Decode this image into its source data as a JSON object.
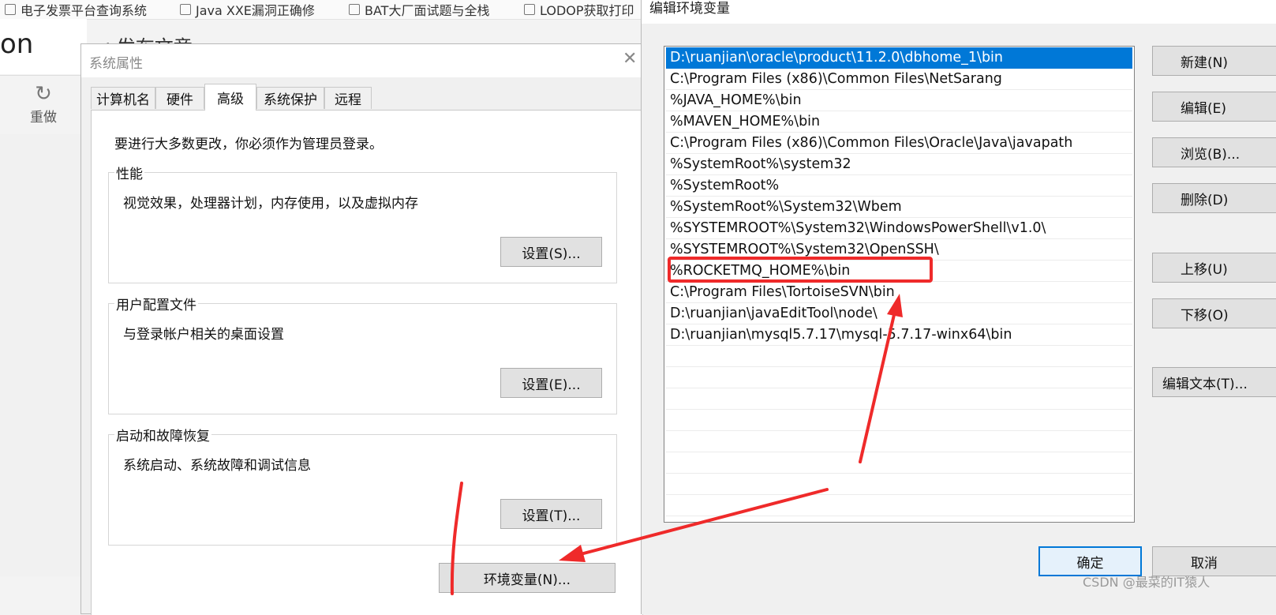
{
  "browser": {
    "bookmarks": [
      "电子发票平台查询系统",
      "Java XXE漏洞正确修",
      "BAT大厂面试题与全栈",
      "LODOP获取打印"
    ],
    "logo_fragment": "on",
    "page_title": "< 发布文章",
    "redo_label": "重做"
  },
  "system_properties": {
    "title": "系统属性",
    "tabs": [
      {
        "label": "计算机名"
      },
      {
        "label": "硬件"
      },
      {
        "label": "高级",
        "active": true
      },
      {
        "label": "系统保护"
      },
      {
        "label": "远程"
      }
    ],
    "admin_note": "要进行大多数更改，你必须作为管理员登录。",
    "groups": [
      {
        "title": "性能",
        "description": "视觉效果，处理器计划，内存使用，以及虚拟内存",
        "button": "设置(S)..."
      },
      {
        "title": "用户配置文件",
        "description": "与登录帐户相关的桌面设置",
        "button": "设置(E)..."
      },
      {
        "title": "启动和故障恢复",
        "description": "系统启动、系统故障和调试信息",
        "button": "设置(T)..."
      }
    ],
    "env_button": "环境变量(N)..."
  },
  "edit_env": {
    "title": "编辑环境变量",
    "paths": [
      "D:\\ruanjian\\oracle\\product\\11.2.0\\dbhome_1\\bin",
      "C:\\Program Files (x86)\\Common Files\\NetSarang",
      "%JAVA_HOME%\\bin",
      "%MAVEN_HOME%\\bin",
      "C:\\Program Files (x86)\\Common Files\\Oracle\\Java\\javapath",
      "%SystemRoot%\\system32",
      "%SystemRoot%",
      "%SystemRoot%\\System32\\Wbem",
      "%SYSTEMROOT%\\System32\\WindowsPowerShell\\v1.0\\",
      "%SYSTEMROOT%\\System32\\OpenSSH\\",
      "%ROCKETMQ_HOME%\\bin",
      "C:\\Program Files\\TortoiseSVN\\bin",
      "D:\\ruanjian\\javaEditTool\\node\\",
      "D:\\ruanjian\\mysql5.7.17\\mysql-5.7.17-winx64\\bin"
    ],
    "selected_index": 0,
    "highlighted_index": 10,
    "buttons": {
      "new": "新建(N)",
      "edit": "编辑(E)",
      "browse": "浏览(B)...",
      "delete": "删除(D)",
      "move_up": "上移(U)",
      "move_down": "下移(O)",
      "edit_text": "编辑文本(T)...",
      "ok": "确定",
      "cancel": "取消"
    }
  },
  "watermark": "CSDN @最菜的IT猿人",
  "colors": {
    "selection": "#0078d7",
    "annotation": "#ef2a2a"
  }
}
